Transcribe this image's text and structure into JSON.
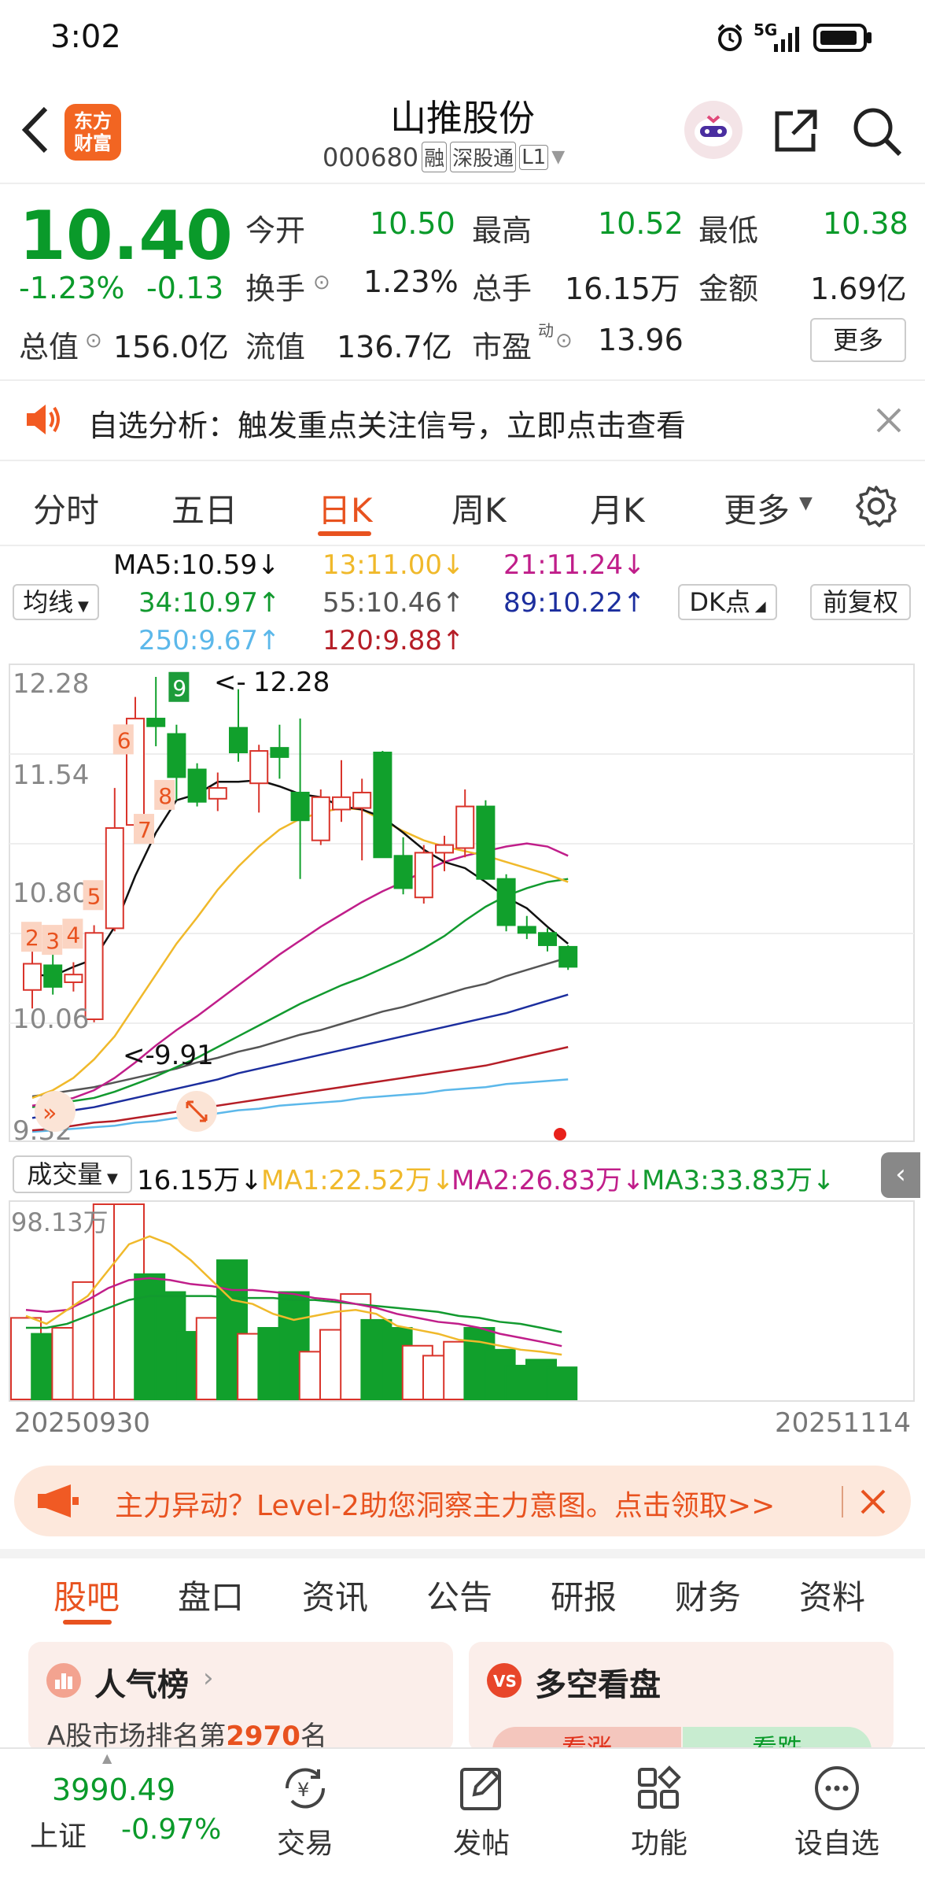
{
  "status": {
    "time": "3:02",
    "signal": "5G"
  },
  "header": {
    "title": "山推股份",
    "code": "000680",
    "tags": [
      "融",
      "深股通",
      "L1"
    ],
    "logo_line1": "东方",
    "logo_line2": "财富"
  },
  "quote": {
    "price": "10.40",
    "change_pct": "-1.23%",
    "change": "-0.13",
    "open_label": "今开",
    "open": "10.50",
    "high_label": "最高",
    "high": "10.52",
    "low_label": "最低",
    "low": "10.38",
    "turnover_label": "换手",
    "turnover": "1.23%",
    "volume_label": "总手",
    "volume": "16.15万",
    "amount_label": "金额",
    "amount": "1.69亿",
    "mktcap_label": "总值",
    "mktcap": "156.0亿",
    "float_label": "流值",
    "float": "136.7亿",
    "pe_label": "市盈",
    "pe_sup": "动",
    "pe": "13.96",
    "more_label": "更多"
  },
  "notice": {
    "text": "自选分析：触发重点关注信号，立即点击查看"
  },
  "chart_tabs": [
    "分时",
    "五日",
    "日K",
    "周K",
    "月K",
    "更多"
  ],
  "chart_tab_active": "日K",
  "ma_legend": {
    "selector": "均线",
    "ma5": "MA5:10.59↓",
    "ma13": "13:11.00↓",
    "ma21": "21:11.24↓",
    "ma34": "34:10.97↑",
    "ma55": "55:10.46↑",
    "ma89": "89:10.22↑",
    "ma250": "250:9.67↑",
    "ma120": "120:9.88↑",
    "dk_label": "DK点",
    "adjust_label": "前复权"
  },
  "price_axis": [
    "12.28",
    "11.54",
    "10.80",
    "10.06",
    "9.32"
  ],
  "price_annotations": {
    "high": "12.28",
    "low": "9.91"
  },
  "signal_labels": [
    "2",
    "3",
    "4",
    "5",
    "6",
    "7",
    "8",
    "9"
  ],
  "volume_legend": {
    "selector": "成交量",
    "vol": "16.15万↓",
    "ma1": "MA1:22.52万↓",
    "ma2": "MA2:26.83万↓",
    "ma3": "MA3:33.83万↓",
    "max": "98.13万"
  },
  "date_range": {
    "start": "20250930",
    "end": "20251114"
  },
  "colors": {
    "up": "#d9342b",
    "down": "#11a02c",
    "ma5": "#111111",
    "ma13": "#f0b92b",
    "ma21": "#c01e8a",
    "ma34": "#129a2f",
    "ma55": "#555555",
    "ma89": "#1c2e9e",
    "ma120": "#b51e27",
    "ma250": "#5cb8ea",
    "accent": "#f06a2a"
  },
  "chart_data": {
    "type": "candlestick",
    "ylim": [
      9.32,
      12.28
    ],
    "candles": [
      {
        "o": 10.25,
        "c": 10.42,
        "h": 10.55,
        "l": 10.13
      },
      {
        "o": 10.41,
        "c": 10.27,
        "h": 10.48,
        "l": 10.22
      },
      {
        "o": 10.3,
        "c": 10.35,
        "h": 10.43,
        "l": 10.24
      },
      {
        "o": 10.06,
        "c": 10.62,
        "h": 10.67,
        "l": 10.04
      },
      {
        "o": 10.65,
        "c": 11.3,
        "h": 11.56,
        "l": 10.63
      },
      {
        "o": 11.32,
        "c": 12.01,
        "h": 12.15,
        "l": 11.24
      },
      {
        "o": 12.01,
        "c": 11.96,
        "h": 12.28,
        "l": 11.83
      },
      {
        "o": 11.91,
        "c": 11.63,
        "h": 11.97,
        "l": 11.48
      },
      {
        "o": 11.68,
        "c": 11.47,
        "h": 11.72,
        "l": 11.44
      },
      {
        "o": 11.49,
        "c": 11.56,
        "h": 11.66,
        "l": 11.41
      },
      {
        "o": 11.95,
        "c": 11.79,
        "h": 12.2,
        "l": 11.73
      },
      {
        "o": 11.59,
        "c": 11.8,
        "h": 11.84,
        "l": 11.4
      },
      {
        "o": 11.82,
        "c": 11.76,
        "h": 11.97,
        "l": 11.62
      },
      {
        "o": 11.53,
        "c": 11.35,
        "h": 12.01,
        "l": 10.97
      },
      {
        "o": 11.22,
        "c": 11.5,
        "h": 11.55,
        "l": 11.19
      },
      {
        "o": 11.42,
        "c": 11.5,
        "h": 11.74,
        "l": 11.34
      },
      {
        "o": 11.43,
        "c": 11.53,
        "h": 11.62,
        "l": 11.09
      },
      {
        "o": 11.79,
        "c": 11.11,
        "h": 11.8,
        "l": 11.11
      },
      {
        "o": 11.12,
        "c": 10.91,
        "h": 11.24,
        "l": 10.87
      },
      {
        "o": 10.85,
        "c": 11.14,
        "h": 11.19,
        "l": 10.81
      },
      {
        "o": 11.14,
        "c": 11.19,
        "h": 11.25,
        "l": 11.02
      },
      {
        "o": 11.17,
        "c": 11.44,
        "h": 11.55,
        "l": 11.11
      },
      {
        "o": 11.44,
        "c": 10.97,
        "h": 11.48,
        "l": 10.97
      },
      {
        "o": 10.97,
        "c": 10.67,
        "h": 11.0,
        "l": 10.63
      },
      {
        "o": 10.66,
        "c": 10.62,
        "h": 10.73,
        "l": 10.58
      },
      {
        "o": 10.62,
        "c": 10.54,
        "h": 10.65,
        "l": 10.5
      },
      {
        "o": 10.53,
        "c": 10.4,
        "h": 10.54,
        "l": 10.38
      }
    ],
    "ma5": [
      10.35,
      10.34,
      10.4,
      10.45,
      10.66,
      10.99,
      11.27,
      11.48,
      11.52,
      11.6,
      11.6,
      11.61,
      11.57,
      11.52,
      11.5,
      11.44,
      11.42,
      11.37,
      11.27,
      11.16,
      11.08,
      11.04,
      10.95,
      10.85,
      10.78,
      10.66,
      10.55
    ],
    "ma13": [
      9.55,
      9.6,
      9.68,
      9.8,
      9.95,
      10.15,
      10.35,
      10.55,
      10.72,
      10.9,
      11.05,
      11.18,
      11.29,
      11.36,
      11.4,
      11.43,
      11.42,
      11.35,
      11.28,
      11.22,
      11.18,
      11.15,
      11.12,
      11.08,
      11.04,
      11.0,
      10.95
    ],
    "ma21": [
      9.5,
      9.52,
      9.55,
      9.6,
      9.68,
      9.78,
      9.89,
      9.99,
      10.08,
      10.18,
      10.28,
      10.38,
      10.48,
      10.57,
      10.66,
      10.74,
      10.82,
      10.89,
      10.95,
      11.02,
      11.08,
      11.12,
      11.15,
      11.18,
      11.2,
      11.18,
      11.12
    ],
    "ma34": [
      9.49,
      9.51,
      9.53,
      9.55,
      9.59,
      9.64,
      9.69,
      9.75,
      9.81,
      9.88,
      9.95,
      10.02,
      10.09,
      10.16,
      10.22,
      10.28,
      10.33,
      10.39,
      10.45,
      10.52,
      10.6,
      10.7,
      10.79,
      10.86,
      10.91,
      10.95,
      10.97
    ],
    "ma55": [
      9.56,
      9.58,
      9.6,
      9.62,
      9.65,
      9.68,
      9.71,
      9.74,
      9.78,
      9.81,
      9.85,
      9.88,
      9.92,
      9.96,
      9.99,
      10.03,
      10.07,
      10.11,
      10.14,
      10.18,
      10.22,
      10.26,
      10.29,
      10.34,
      10.38,
      10.42,
      10.46
    ],
    "ma89": [
      9.42,
      9.44,
      9.47,
      9.49,
      9.52,
      9.55,
      9.58,
      9.61,
      9.64,
      9.67,
      9.71,
      9.74,
      9.77,
      9.8,
      9.83,
      9.86,
      9.89,
      9.92,
      9.95,
      9.98,
      10.01,
      10.04,
      10.07,
      10.1,
      10.14,
      10.18,
      10.22
    ],
    "ma120": [
      9.34,
      9.35,
      9.37,
      9.39,
      9.4,
      9.42,
      9.44,
      9.46,
      9.48,
      9.5,
      9.52,
      9.54,
      9.56,
      9.58,
      9.6,
      9.62,
      9.64,
      9.66,
      9.68,
      9.7,
      9.72,
      9.74,
      9.76,
      9.79,
      9.82,
      9.85,
      9.88
    ],
    "ma250": [
      9.33,
      9.34,
      9.35,
      9.36,
      9.37,
      9.39,
      9.4,
      9.42,
      9.43,
      9.45,
      9.47,
      9.48,
      9.5,
      9.51,
      9.52,
      9.53,
      9.55,
      9.56,
      9.57,
      9.58,
      9.6,
      9.61,
      9.62,
      9.64,
      9.65,
      9.66,
      9.67
    ],
    "volume": [
      41,
      33,
      36,
      59,
      98.13,
      98.13,
      63,
      54,
      34,
      41,
      70,
      33,
      36,
      54,
      24,
      35,
      53,
      40,
      36,
      27,
      22,
      29,
      36,
      25,
      17,
      20,
      16.15
    ],
    "vol_ma1": [
      42,
      38,
      45,
      52,
      65,
      78,
      82,
      78,
      70,
      60,
      50,
      48,
      43,
      40,
      42,
      44,
      45,
      43,
      37,
      35,
      33,
      30,
      29,
      27,
      25,
      24,
      22.52
    ],
    "vol_ma2": [
      45,
      44,
      45,
      50,
      56,
      60,
      61,
      60,
      58,
      57,
      55,
      55,
      54,
      53,
      51,
      50,
      48,
      46,
      43,
      41,
      39,
      38,
      36,
      33,
      31,
      29,
      26.83
    ],
    "vol_ma3": [
      36,
      36,
      38,
      42,
      46,
      50,
      52,
      52,
      52,
      52,
      51,
      51,
      51,
      50,
      50,
      49,
      48,
      47,
      46,
      45,
      44,
      42,
      41,
      39,
      38,
      36,
      33.83
    ]
  },
  "ad_banner": {
    "text": "主力异动？Level-2助您洞察主力意图。点击领取>>"
  },
  "info_tabs": [
    "股吧",
    "盘口",
    "资讯",
    "公告",
    "研报",
    "财务",
    "资料"
  ],
  "info_tab_active": "股吧",
  "cards": {
    "left_title": "人气榜",
    "left_sub_prefix": "A股市场排名第",
    "left_rank": "2970",
    "left_sub_suffix": "名",
    "right_title": "多空看盘",
    "bull": "看涨",
    "bear": "看跌"
  },
  "bottom_nav": {
    "index_value": "3990.49",
    "index_name": "上证",
    "index_change": "-0.97%",
    "items": [
      "交易",
      "发帖",
      "功能",
      "设自选"
    ]
  }
}
